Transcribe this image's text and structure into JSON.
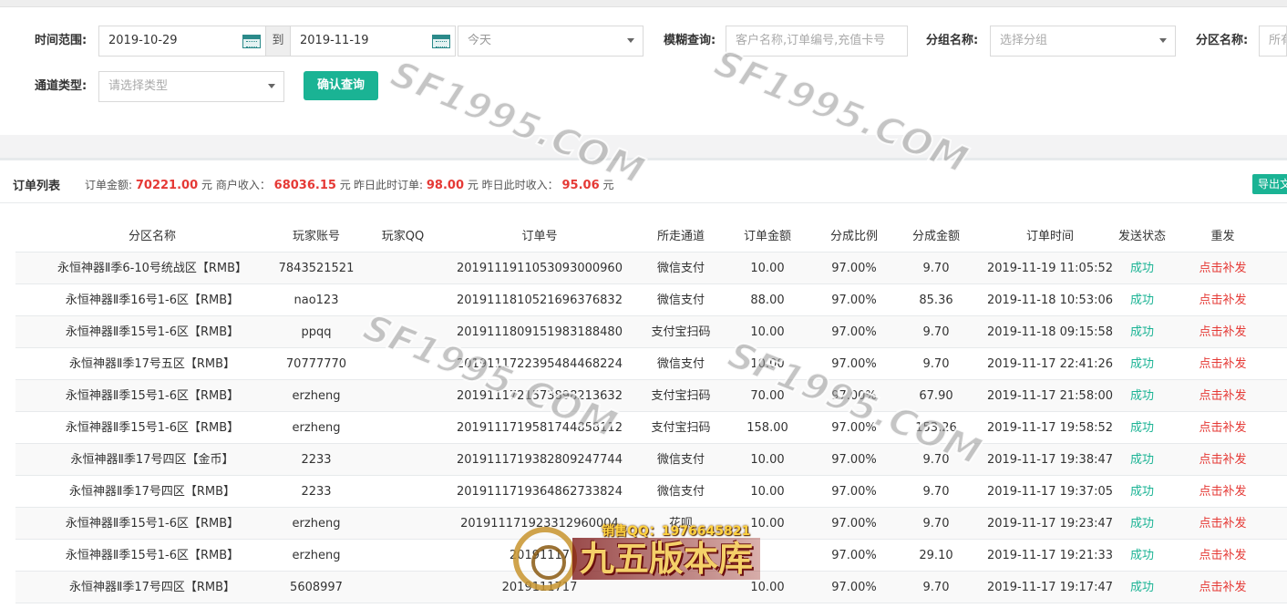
{
  "filters": {
    "time_range_label": "时间范围:",
    "date_start": "2019-10-29",
    "to_label": "到",
    "date_end": "2019-11-19",
    "preset": "今天",
    "fuzzy_label": "模糊查询:",
    "fuzzy_placeholder": "客户名称,订单编号,充值卡号",
    "group_label": "分组名称:",
    "group_placeholder": "选择分组",
    "zone_label": "分区名称:",
    "zone_placeholder": "所有",
    "channel_label": "通道类型:",
    "channel_placeholder": "请选择类型",
    "confirm_button": "确认查询"
  },
  "summary": {
    "title": "订单列表",
    "order_amount_label": "订单金额:",
    "order_amount": "70221.00",
    "unit1": "元",
    "merchant_income_label": "商户收入：",
    "merchant_income": "68036.15",
    "unit2": "元",
    "yesterday_orders_label": "昨日此时订单:",
    "yesterday_orders": "98.00",
    "unit3": "元",
    "yesterday_income_label": "昨日此时收入：",
    "yesterday_income": "95.06",
    "unit4": "元",
    "export_button": "导出文"
  },
  "table": {
    "headers": [
      "分区名称",
      "玩家账号",
      "玩家QQ",
      "订单号",
      "所走通道",
      "订单金额",
      "分成比例",
      "分成金额",
      "订单时间",
      "发送状态",
      "重发"
    ],
    "rows": [
      [
        "永恒神器Ⅱ季6-10号统战区【RMB】",
        "7843521521",
        "",
        "20191119110530930009​60",
        "微信支付",
        "10.00",
        "97.00%",
        "9.70",
        "2019-11-19 11:05:52",
        "成功",
        "点击补发"
      ],
      [
        "永恒神器Ⅱ季16号1-6区【RMB】",
        "nao123",
        "",
        "20191118105216963768​32",
        "微信支付",
        "88.00",
        "97.00%",
        "85.36",
        "2019-11-18 10:53:06",
        "成功",
        "点击补发"
      ],
      [
        "永恒神器Ⅱ季15号1-6区【RMB】",
        "ppqq",
        "",
        "20191118091519831884​80",
        "支付宝扫码",
        "10.00",
        "97.00%",
        "9.70",
        "2019-11-18 09:15:58",
        "成功",
        "点击补发"
      ],
      [
        "永恒神器Ⅱ季17号五区【RMB】",
        "70777770",
        "",
        "20191117223954844682​24",
        "微信支付",
        "10.00",
        "97.00%",
        "9.70",
        "2019-11-17 22:41:26",
        "成功",
        "点击补发"
      ],
      [
        "永恒神器Ⅱ季15号1-6区【RMB】",
        "erzheng",
        "",
        "20191117215738982136​32",
        "支付宝扫码",
        "70.00",
        "97.00%",
        "67.90",
        "2019-11-17 21:58:00",
        "成功",
        "点击补发"
      ],
      [
        "永恒神器Ⅱ季15号1-6区【RMB】",
        "erzheng",
        "",
        "20191117195817448581​12",
        "支付宝扫码",
        "158.00",
        "97.00%",
        "153.26",
        "2019-11-17 19:58:52",
        "成功",
        "点击补发"
      ],
      [
        "永恒神器Ⅱ季17号四区【金币】",
        "2233",
        "",
        "20191117193828092477​44",
        "微信支付",
        "10.00",
        "97.00%",
        "9.70",
        "2019-11-17 19:38:47",
        "成功",
        "点击补发"
      ],
      [
        "永恒神器Ⅱ季17号四区【RMB】",
        "2233",
        "",
        "20191117193648627338​24",
        "微信支付",
        "10.00",
        "97.00%",
        "9.70",
        "2019-11-17 19:37:05",
        "成功",
        "点击补发"
      ],
      [
        "永恒神器Ⅱ季15号1-6区【RMB】",
        "erzheng",
        "",
        "201911171923312960004",
        "花呗",
        "10.00",
        "97.00%",
        "9.70",
        "2019-11-17 19:23:47",
        "成功",
        "点击补发"
      ],
      [
        "永恒神器Ⅱ季15号1-6区【RMB】",
        "erzheng",
        "",
        "20191117",
        "",
        "",
        "97.00%",
        "29.10",
        "2019-11-17 19:21:33",
        "成功",
        "点击补发"
      ],
      [
        "永恒神器Ⅱ季17号四区【RMB】",
        "5608997",
        "",
        "2019111717",
        "",
        "10.00",
        "97.00%",
        "9.70",
        "2019-11-17 19:17:47",
        "成功",
        "点击补发"
      ]
    ]
  },
  "watermark": {
    "text": "SF1995.COM",
    "promo": "销售QQ：1976645821",
    "logo": "九五版本库"
  },
  "colors": {
    "accent": "#1ab394",
    "money": "#e53935",
    "success": "#1ab394",
    "resend": "#e53935"
  }
}
